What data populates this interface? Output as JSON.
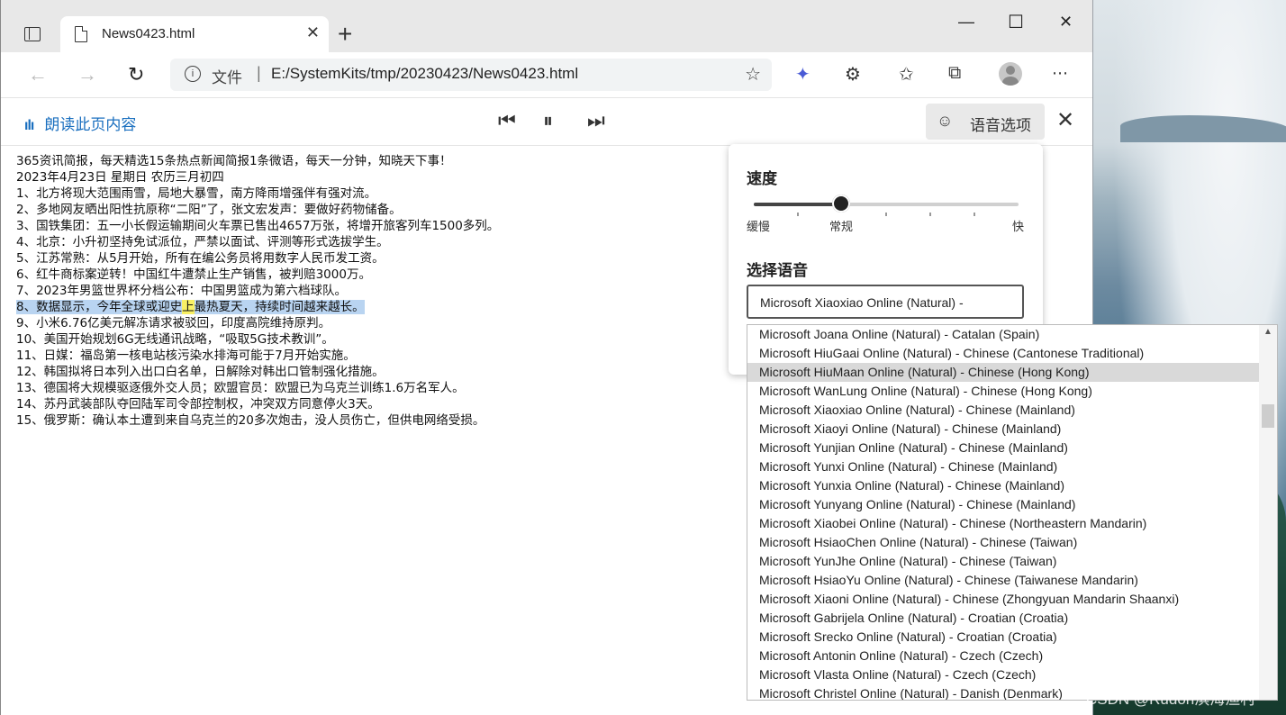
{
  "browser": {
    "tab_title": "News0423.html",
    "new_tab": "+",
    "address": {
      "scheme_label": "文件",
      "separator": "|",
      "url": "E:/SystemKits/tmp/20230423/News0423.html"
    }
  },
  "read_aloud": {
    "label": "朗读此页内容",
    "voice_options_label": "语音选项"
  },
  "article": {
    "lines": [
      "365资讯简报，每天精选15条热点新闻简报1条微语，每天一分钟，知晓天下事！",
      "2023年4月23日  星期日  农历三月初四",
      "1、北方将现大范围雨雪，局地大暴雪，南方降雨增强伴有强对流。",
      "2、多地网友晒出阳性抗原称“二阳”了，张文宏发声：要做好药物储备。",
      "3、国铁集团：五一小长假运输期间火车票已售出4657万张，将增开旅客列车1500多列。",
      "4、北京：小升初坚持免试派位，严禁以面试、评测等形式选拔学生。",
      "5、江苏常熟：从5月开始，所有在编公务员将用数字人民币发工资。",
      "6、红牛商标案逆转！中国红牛遭禁止生产销售，被判赔3000万。",
      "7、2023年男篮世界杯分档公布：中国男篮成为第六档球队。",
      "9、小米6.76亿美元解冻请求被驳回，印度高院维持原判。",
      "10、美国开始规划6G无线通讯战略，“吸取5G技术教训”。",
      "11、日媒：福岛第一核电站核污染水排海可能于7月开始实施。",
      "12、韩国拟将日本列入出口白名单，日解除对韩出口管制强化措施。",
      "13、德国将大规模驱逐俄外交人员；欧盟官员：欧盟已为乌克兰训练1.6万名军人。",
      "14、苏丹武装部队夺回陆军司令部控制权，冲突双方同意停火3天。",
      "15、俄罗斯：确认本土遭到来自乌克兰的20多次炮击，没人员伤亡，但供电网络受损。"
    ],
    "highlighted_line": {
      "before": "8、数据显示，今年全球或迎史",
      "current_word": "上",
      "after": "最热夏天，持续时间越来越长。"
    }
  },
  "voice_panel": {
    "speed_heading": "速度",
    "speed_labels": {
      "slow": "缓慢",
      "normal": "常规",
      "fast": "快"
    },
    "speed_position": 0.33,
    "voice_heading": "选择语音",
    "selected_voice": "Microsoft Xiaoxiao Online (Natural) -"
  },
  "voice_list": [
    "Microsoft Joana Online (Natural) - Catalan (Spain)",
    "Microsoft HiuGaai Online (Natural) - Chinese (Cantonese Traditional)",
    "Microsoft HiuMaan Online (Natural) - Chinese (Hong Kong)",
    "Microsoft WanLung Online (Natural) - Chinese (Hong Kong)",
    "Microsoft Xiaoxiao Online (Natural) - Chinese (Mainland)",
    "Microsoft Xiaoyi Online (Natural) - Chinese (Mainland)",
    "Microsoft Yunjian Online (Natural) - Chinese (Mainland)",
    "Microsoft Yunxi Online (Natural) - Chinese (Mainland)",
    "Microsoft Yunxia Online (Natural) - Chinese (Mainland)",
    "Microsoft Yunyang Online (Natural) - Chinese (Mainland)",
    "Microsoft Xiaobei Online (Natural) - Chinese (Northeastern Mandarin)",
    "Microsoft HsiaoChen Online (Natural) - Chinese (Taiwan)",
    "Microsoft YunJhe Online (Natural) - Chinese (Taiwan)",
    "Microsoft HsiaoYu Online (Natural) - Chinese (Taiwanese Mandarin)",
    "Microsoft Xiaoni Online (Natural) - Chinese (Zhongyuan Mandarin Shaanxi)",
    "Microsoft Gabrijela Online (Natural) - Croatian (Croatia)",
    "Microsoft Srecko Online (Natural) - Croatian (Croatia)",
    "Microsoft Antonin Online (Natural) - Czech (Czech)",
    "Microsoft Vlasta Online (Natural) - Czech (Czech)",
    "Microsoft Christel Online (Natural) - Danish (Denmark)"
  ],
  "voice_list_highlighted_index": 2,
  "watermark": "CSDN @Rudon滨海渔村"
}
